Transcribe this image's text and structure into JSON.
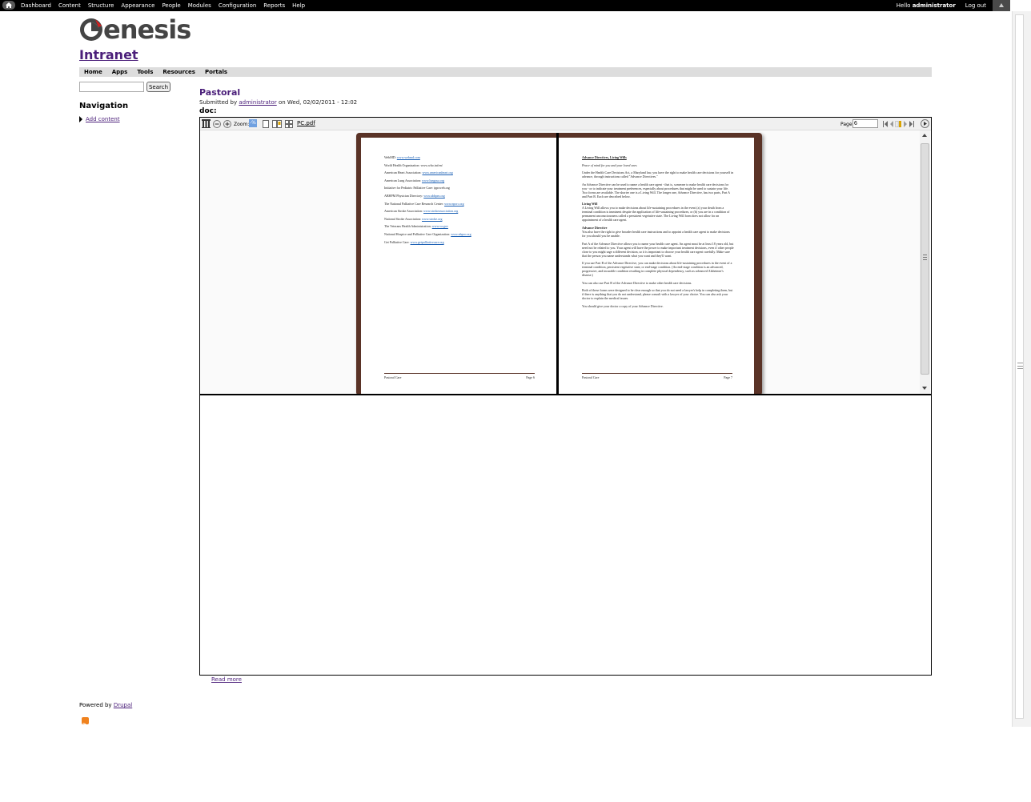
{
  "admin_toolbar": {
    "menu": [
      "Dashboard",
      "Content",
      "Structure",
      "Appearance",
      "People",
      "Modules",
      "Configuration",
      "Reports",
      "Help"
    ],
    "greeting_prefix": "Hello",
    "username": "administrator",
    "logout": "Log out"
  },
  "site": {
    "logo_text": "enesis",
    "name": "Intranet"
  },
  "primary_nav": [
    "Home",
    "Apps",
    "Tools",
    "Resources",
    "Portals"
  ],
  "search": {
    "value": "",
    "button": "Search"
  },
  "sidebar": {
    "heading": "Navigation",
    "add_content": "Add content"
  },
  "node": {
    "title": "Pastoral",
    "submitted_prefix": "Submitted by",
    "author": "administrator",
    "submitted_suffix": "on Wed, 02/02/2011 - 12:02",
    "field_label": "doc:"
  },
  "viewer": {
    "zoom_label": "Zoom:",
    "zoom_value": "-%",
    "filename": "PC.pdf",
    "page_label": "Page",
    "page_value": "6",
    "left_page": {
      "lines": [
        {
          "label": "WebMD:",
          "link": "www.webmd.com"
        },
        {
          "label": "World Health Organization:",
          "text": "www.who.int/en/"
        },
        {
          "label": "American Heart Association:",
          "link": "www.americanheart.org"
        },
        {
          "label": "American Lung Association:",
          "link": "www.lungusa.org"
        },
        {
          "label": "Initiative for Pediatric Palliative Care:",
          "text": "ippcweb.org"
        },
        {
          "label": "ABHPM Physician Directory:",
          "link": "www.abhpm.org"
        },
        {
          "label": "The National Palliative Care Research Center:",
          "link": "www.npcrc.org"
        },
        {
          "label": "American Stroke Association:",
          "link": "www.strokeassociation.org"
        },
        {
          "label": "National Stroke Association:",
          "link": "www.stroke.org"
        },
        {
          "label": "The Veterans Health Administration:",
          "link": "www.va.gov"
        },
        {
          "label": "National Hospice and Palliative Care Organization:",
          "link": "www.nhpco.org"
        },
        {
          "label": "Get Palliative Care:",
          "link": "www.getpalliativecare.org"
        }
      ],
      "footer_left": "Pastoral Care",
      "footer_right": "Page 6"
    },
    "right_page": {
      "heading": "Advance Directives, Living Wills",
      "subheading": "Peace of mind for you and your loved ones",
      "p1": "Under the Health Care Decisions Act, a Maryland law, you have the right to make health care decisions for yourself in advance, through instructions called \"Advance Directives.\"",
      "p2": "An Advance Directive can be used to name a health care agent - that is, someone to make health care decisions for you - or to indicate your treatment preferences, especially about procedures that might be used to sustain your life. Two forms are available. The shorter one is a Living Will. The longer one, Advance Directive, has two parts, Part A and Part B. Each are described below.",
      "h_living_will": "Living Will",
      "p3": "A Living Will allows you to make decisions about life-sustaining procedures in the event (a) your death from a terminal condition is imminent despite the application of life-sustaining procedures, or (b) you are in a condition of permanent unconsciousness called a persistent vegetative state. The Living Will form does not allow for an appointment of a health care agent.",
      "h_advance": "Advance Directive",
      "p4": "You also have the right to give broader health care instructions and to appoint a health care agent to make decisions for you should you be unable.",
      "p5": "Part A of the Advance Directive allows you to name your health care agent. An agent must be at least 18 years old, but need not be related to you. Your agent will have the power to make important treatment decisions, even if other people close to you might urge a different decision, so it is important to choose your health care agent carefully. Make sure that the person you name understands what you want and they'll want.",
      "p6": "If you use Part B of the Advance Directive, you can make decisions about life-sustaining procedures in the event of a terminal condition, persistent vegetative state, or end-stage condition. (An end-stage condition is an advanced, progressive, and incurable condition resulting in complete physical dependency, such as advanced Alzheimer's disease.)",
      "p7": "You can also use Part B of the Advance Directive to make other health care decisions.",
      "p8": "Both of these forms were designed to be clear enough so that you do not need a lawyer's help in completing them, but if there is anything that you do not understand, please consult with a lawyer of your choice. You can also ask your doctor to explain the medical issues.",
      "p9": "You should give your doctor a copy of your Advance Directive.",
      "footer_left": "Pastoral Care",
      "footer_right": "Page 7"
    }
  },
  "read_more": "Read more",
  "footer": {
    "powered_prefix": "Powered by",
    "powered_link": "Drupal"
  },
  "colors": {
    "link": "#4b1f7a",
    "book_cover": "#5a3327",
    "toolbar_bg": "#000000"
  }
}
